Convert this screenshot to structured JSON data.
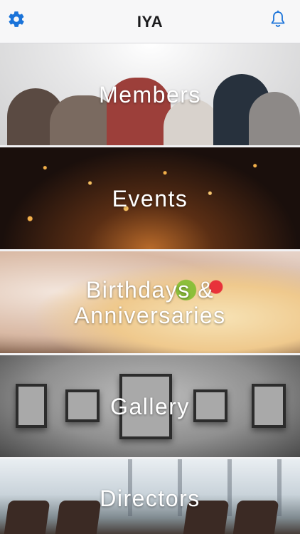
{
  "app": {
    "title": "IYA"
  },
  "navbar": {
    "settings_icon": "gear-icon",
    "notifications_icon": "bell-icon",
    "accent_color": "#1a73d9"
  },
  "tiles": [
    {
      "label": "Members",
      "image": "group-of-friends-photo"
    },
    {
      "label": "Events",
      "image": "sky-lanterns-photo"
    },
    {
      "label": "Birthdays &\nAnniversaries",
      "image": "cake-photo"
    },
    {
      "label": "Gallery",
      "image": "picture-frames-photo"
    },
    {
      "label": "Directors",
      "image": "conference-hall-photo"
    }
  ]
}
